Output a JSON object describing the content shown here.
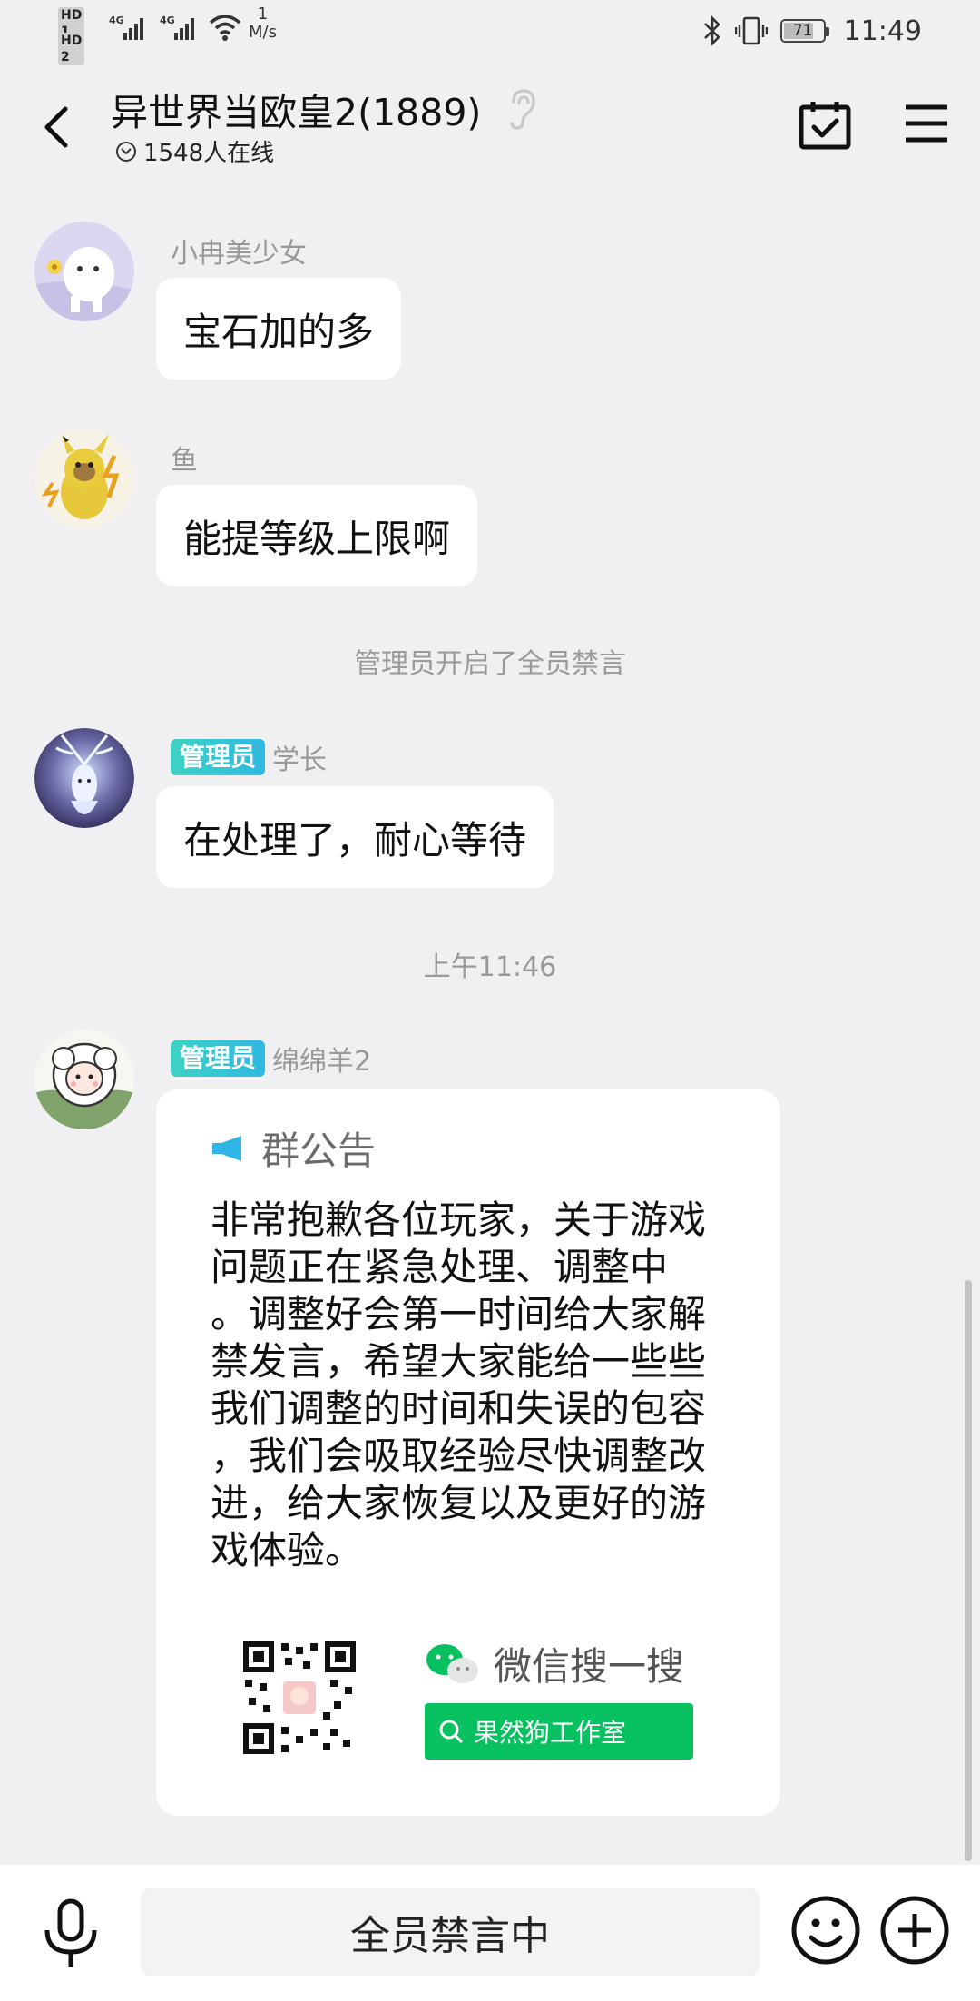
{
  "status_bar": {
    "sim1": "HD 1",
    "sim2": "HD 2",
    "net1": "4G",
    "net2": "4G",
    "speed_value": "1",
    "speed_unit": "M/s",
    "battery": "71",
    "time": "11:49"
  },
  "header": {
    "title": "异世界当欧皇2(1889)",
    "online": "1548人在线",
    "icons": [
      "back-arrow-icon",
      "ear-icon",
      "calendar-check-icon",
      "menu-icon"
    ]
  },
  "messages": [
    {
      "sender": "小冉美少女",
      "admin": false,
      "text": "宝石加的多"
    },
    {
      "sender": "鱼",
      "admin": false,
      "text": "能提等级上限啊"
    }
  ],
  "system_notice": "管理员开启了全员禁言",
  "admin_message": {
    "badge": "管理员",
    "sender": "学长",
    "text": "在处理了，耐心等待"
  },
  "timestamp": "上午11:46",
  "announcement": {
    "badge": "管理员",
    "sender": "绵绵羊2",
    "label": "群公告",
    "lines": [
      "非常抱歉各位玩家，关于游戏",
      "问题正在紧急处理、调整中",
      "。调整好会第一时间给大家解",
      "禁发言，希望大家能给一些些",
      "我们调整的时间和失误的包容",
      "，我们会吸取经验尽快调整改",
      "进，给大家恢复以及更好的游",
      "戏体验。"
    ],
    "wechat_label": "微信搜一搜",
    "wechat_search": "果然狗工作室"
  },
  "input_bar": {
    "muted_text": "全员禁言中",
    "icons": [
      "microphone-icon",
      "emoji-icon",
      "plus-icon"
    ]
  }
}
